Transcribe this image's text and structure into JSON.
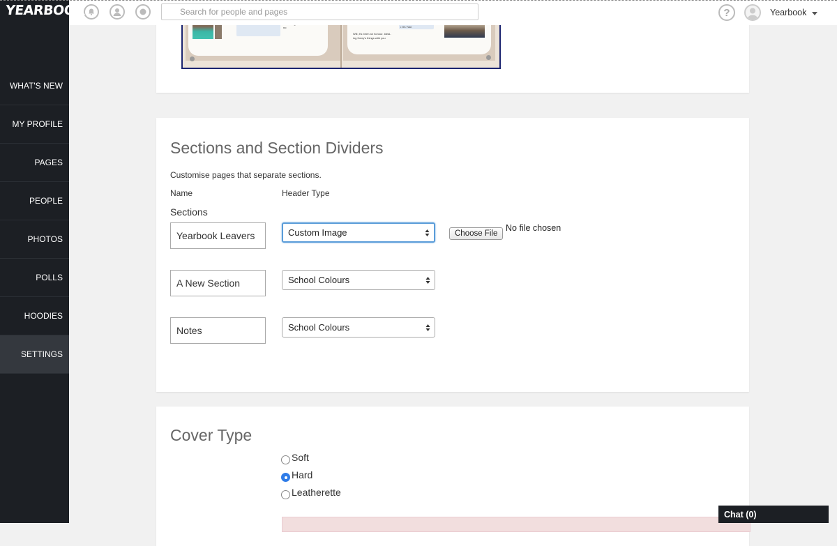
{
  "app": {
    "logo": "YEARBOOK",
    "search_placeholder": "Search for people and pages",
    "help_symbol": "?",
    "user_name": "Yearbook"
  },
  "sidebar": {
    "items": [
      {
        "label": "WHAT'S NEW"
      },
      {
        "label": "MY PROFILE"
      },
      {
        "label": "PAGES"
      },
      {
        "label": "PEOPLE"
      },
      {
        "label": "PHOTOS"
      },
      {
        "label": "POLLS"
      },
      {
        "label": "HOODIES"
      },
      {
        "label": "SETTINGS",
        "active": true
      }
    ]
  },
  "header_icons": [
    "bell-icon",
    "profile-icon",
    "chat-bubble-icon",
    "help-icon",
    "user-avatar-icon"
  ],
  "sections_card": {
    "title": "Sections and Section Dividers",
    "description": "Customise pages that separate sections.",
    "col_name": "Name",
    "col_header_type": "Header Type",
    "group_label": "Sections",
    "rows": [
      {
        "name": "Yearbook Leavers",
        "header_type": "Custom Image"
      },
      {
        "name": "A New Section",
        "header_type": "School Colours"
      },
      {
        "name": "Notes",
        "header_type": "School Colours"
      }
    ],
    "file_button": "Choose File",
    "file_status": "No file chosen"
  },
  "cover_card": {
    "title": "Cover Type",
    "options": [
      {
        "label": "Soft",
        "checked": false
      },
      {
        "label": "Hard",
        "checked": true
      },
      {
        "label": "Leatherette",
        "checked": false
      }
    ]
  },
  "chat": {
    "label": "Chat (0)"
  },
  "colors": {
    "sidebar_bg": "#1c1f24",
    "sidebar_active": "#34383e",
    "focus_blue": "#5b9dd9",
    "radio_checked": "#2f7ce8",
    "preview_border": "#1b2470"
  }
}
